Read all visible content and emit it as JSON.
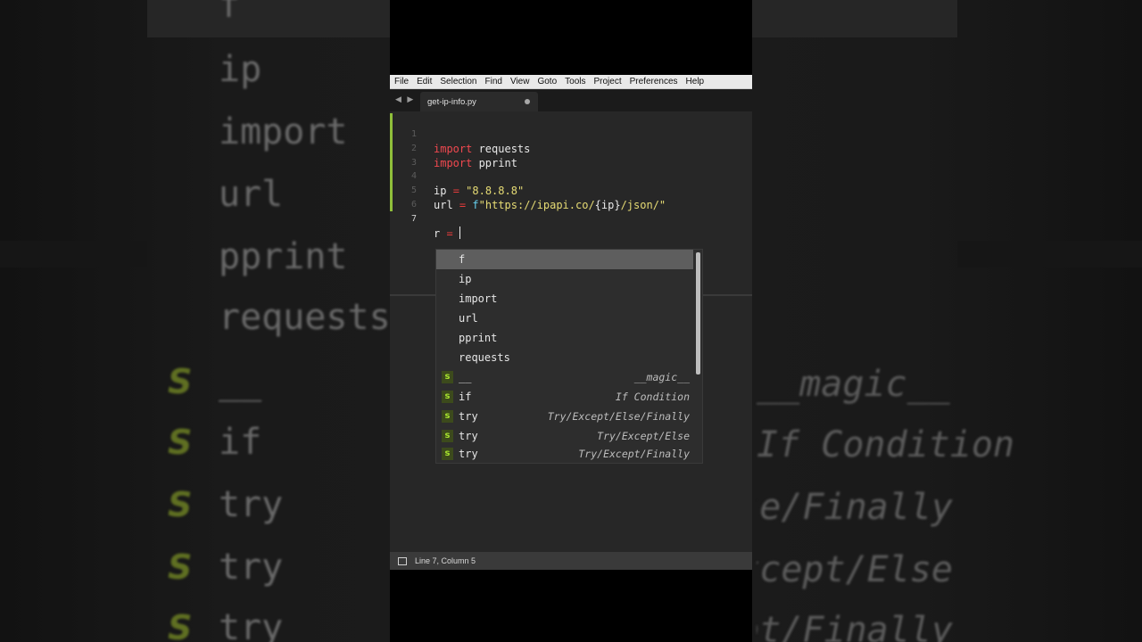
{
  "backdrop": {
    "words": [
      "f",
      "ip",
      "import",
      "url",
      "pprint",
      "requests",
      "__",
      "if",
      "try",
      "try",
      "try"
    ],
    "snippet_marker": "S",
    "descriptions": [
      "__magic__",
      "If Condition",
      "Try/Except/Else/Finally",
      "Try/Except/Else",
      "Try/Except/Finally"
    ]
  },
  "menu": [
    "File",
    "Edit",
    "Selection",
    "Find",
    "View",
    "Goto",
    "Tools",
    "Project",
    "Preferences",
    "Help"
  ],
  "tabs": {
    "nav_arrows": "◀ ▶",
    "active_tab": "get-ip-info.py"
  },
  "code": {
    "line_numbers": [
      "1",
      "2",
      "3",
      "4",
      "5",
      "6",
      "7"
    ],
    "line1": {
      "kw": "import",
      "rest": " requests"
    },
    "line2": {
      "kw": "import",
      "rest": " pprint"
    },
    "line4": {
      "var": "ip",
      "op": "=",
      "str": "\"8.8.8.8\""
    },
    "line5": {
      "var": "url",
      "op": "=",
      "prefix": "f",
      "str": "\"https://ipapi.co/",
      "brace": "{ip}",
      "str_end": "/json/\""
    },
    "line7": {
      "var": "r",
      "op": "="
    }
  },
  "autocomplete": {
    "items": [
      {
        "kind": "",
        "word": "f",
        "desc": ""
      },
      {
        "kind": "",
        "word": "ip",
        "desc": ""
      },
      {
        "kind": "",
        "word": "import",
        "desc": ""
      },
      {
        "kind": "",
        "word": "url",
        "desc": ""
      },
      {
        "kind": "",
        "word": "pprint",
        "desc": ""
      },
      {
        "kind": "",
        "word": "requests",
        "desc": ""
      },
      {
        "kind": "s",
        "word": "__",
        "desc": "__magic__"
      },
      {
        "kind": "s",
        "word": "if",
        "desc": "If Condition"
      },
      {
        "kind": "s",
        "word": "try",
        "desc": "Try/Except/Else/Finally"
      },
      {
        "kind": "s",
        "word": "try",
        "desc": "Try/Except/Else"
      },
      {
        "kind": "s",
        "word": "try",
        "desc": "Try/Except/Finally"
      }
    ]
  },
  "status": {
    "position": "Line 7, Column 5"
  },
  "colors": {
    "keyword": "#f0484f",
    "string": "#e6db74",
    "fstring_prefix": "#66d0ef",
    "snippet_badge": "#a6e22e",
    "modified_gutter": "#8fbf3a"
  }
}
